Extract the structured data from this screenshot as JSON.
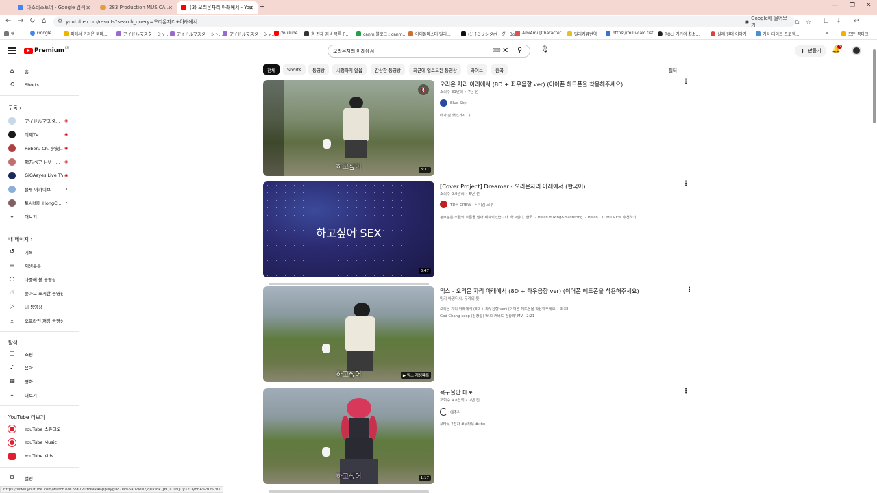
{
  "browser": {
    "tabs": [
      {
        "label": "아소비스토어 - Google 검색",
        "favicon_color": "#4285f4"
      },
      {
        "label": "283 Production MUSICAL Perf",
        "favicon_color": "#e0a040"
      },
      {
        "label": "(3) 오리온자리 아래에서 - You",
        "favicon_color": "#ff0000"
      }
    ],
    "url": "youtube.com/results?search_query=오리온자리+아래에서",
    "google_chip": "Google에 물어보기",
    "bookmarks": [
      {
        "label": "앱",
        "color": "#777"
      },
      {
        "label": "Google",
        "color": "#4285f4"
      },
      {
        "label": "파에서 가져온 북마...",
        "color": "#f0b400"
      },
      {
        "label": "アイドルマスター シャ...",
        "color": "#9a6ad0"
      },
      {
        "label": "アイドルマスター シャ...",
        "color": "#9a6ad0"
      },
      {
        "label": "アイドルマスター シャ...",
        "color": "#9a6ad0"
      },
      {
        "label": "YouTube",
        "color": "#ff0000"
      },
      {
        "label": "홈 전체 검색 목록 F...",
        "color": "#333"
      },
      {
        "label": "canm 블로그 : canm...",
        "color": "#2a9d4a"
      },
      {
        "label": "아이돌마스터 밀리...",
        "color": "#d07030"
      },
      {
        "label": "(1) [ミリシタボーダーBot...",
        "color": "#111"
      },
      {
        "label": "AmiAmi [Character...",
        "color": "#e05050"
      },
      {
        "label": "밀리커뮤번역",
        "color": "#e8c020"
      },
      {
        "label": "https://milli-calc.tist...",
        "color": "#3b6fd0"
      },
      {
        "label": "ROLI 기기의 최소...",
        "color": "#222"
      },
      {
        "label": "실제 원더 이야기",
        "color": "#e04040"
      },
      {
        "label": "기타 데이트 프로젝...",
        "color": "#4a90d0"
      },
      {
        "label": "모든 북마크",
        "color": "#f0b400"
      }
    ]
  },
  "youtube": {
    "logo_text": "Premium",
    "logo_region": "KR",
    "search_query": "오리온자리 아래에서",
    "create_label": "만들기",
    "notif_count": "3"
  },
  "sidebar": {
    "main": [
      {
        "label": "홈",
        "icon": "home-icon",
        "glyph": "⌂"
      },
      {
        "label": "Shorts",
        "icon": "shorts-icon",
        "glyph": "⟲"
      }
    ],
    "subs_header": "구독",
    "subs": [
      {
        "label": "アイドルマスタ...",
        "color": "#c8d8e8",
        "status": "live"
      },
      {
        "label": "미재TV",
        "color": "#1a1a1a",
        "status": "live"
      },
      {
        "label": "Roberu Ch. 夕刻...",
        "color": "#b04040",
        "status": "live"
      },
      {
        "label": "熊乃ベアトリー...",
        "color": "#c07070",
        "status": "live"
      },
      {
        "label": "GiGAeyes Live TV",
        "color": "#1a2a5a",
        "status": "live"
      },
      {
        "label": "블루 아카이브",
        "color": "#8ab0d8",
        "status": "dot"
      },
      {
        "label": "토시네마 HongCi...",
        "color": "#806060",
        "status": "dot"
      }
    ],
    "subs_more": "더보기",
    "you_header": "내 페이지",
    "you": [
      {
        "label": "기록",
        "icon": "history-icon",
        "glyph": "↺"
      },
      {
        "label": "재생목록",
        "icon": "playlist-icon",
        "glyph": "≡"
      },
      {
        "label": "나중에 볼 동영상",
        "icon": "watch-later-icon",
        "glyph": "◷"
      },
      {
        "label": "좋아요 표시한 동영상",
        "icon": "thumbs-up-icon",
        "glyph": "👍"
      },
      {
        "label": "내 동영상",
        "icon": "your-videos-icon",
        "glyph": "▶"
      },
      {
        "label": "오프라인 저장 동영상",
        "icon": "download-icon",
        "glyph": "⤓"
      }
    ],
    "explore_header": "탐색",
    "explore": [
      {
        "label": "쇼핑",
        "icon": "shopping-icon",
        "glyph": "🛍"
      },
      {
        "label": "음악",
        "icon": "music-icon",
        "glyph": "♪"
      },
      {
        "label": "영화",
        "icon": "film-icon",
        "glyph": "▦"
      },
      {
        "label": "더보기",
        "icon": "chevron-down-icon",
        "glyph": "⌄"
      }
    ],
    "more_header": "YouTube 더보기",
    "more": [
      {
        "label": "YouTube 스튜디오",
        "icon": "studio-icon"
      },
      {
        "label": "YouTube Music",
        "icon": "yt-music-icon"
      },
      {
        "label": "YouTube Kids",
        "icon": "yt-kids-icon"
      }
    ],
    "settings": "설정"
  },
  "chips": [
    "전체",
    "Shorts",
    "동영상",
    "시청하지 않음",
    "감상한 동영상",
    "최근에 업로드된 동영상",
    "라이브",
    "원곡"
  ],
  "filter_label": "필터",
  "results": [
    {
      "title": "오리온 자리 아래에서 (8D + 좌우음향 ver) (이어폰 헤드폰을 착용해주세요)",
      "meta": "조회수 31만회 • 7년 전",
      "channel": "Blue Sky",
      "channel_color": "#2a4aa0",
      "desc": "내가 잘 했었거지...)",
      "desc2": "",
      "duration": "3:37",
      "caption": "하고싶어",
      "thumb_kind": "field"
    },
    {
      "title": "[Cover Project] Dreamer - 오리온자리 아래에서 (한국어)",
      "meta": "조회수 9.9만회 • 5년 전",
      "channel": "TDM CREW - 티디엠 크루",
      "channel_color": "#c02020",
      "desc": "정부분은 소원의 흐름을 받아 제작되었습니다. 학교실다, 한국 G.Hwan mixing&mastering G.Hwan · TDM CREW 추천하기 ...",
      "desc2": "",
      "duration": "3:47",
      "caption": "하고싶어 SEX",
      "thumb_kind": "galaxy"
    },
    {
      "title": "믹스 - 오리온 자리 아래에서 (8D + 좌우음향 ver) (이어폰 헤드폰을 착용해주세요)",
      "meta": "밍키 아밍티시, 우리의 뜻",
      "channel": "",
      "channel_color": "",
      "desc": "오리온 자리 아래에서 (8D + 좌우음향 ver) (이어폰 헤드폰을 착용해주세요) · 3:38",
      "desc2": "God Chang-seop (신창섭) '비오 커버도 정상화' MV · 2:21",
      "duration": "믹스 재생목록",
      "caption": "하고싶어",
      "thumb_kind": "field"
    },
    {
      "title": "욕구불만 테토",
      "meta": "조회수 4.8만회 • 2년 전",
      "channel": "예추리",
      "channel_color": "#ffffff",
      "desc": "우타우 2집자 #우타우 #utau",
      "desc2": "",
      "duration": "1:17",
      "caption": "하고싶어",
      "thumb_kind": "teto"
    }
  ],
  "status_url": "https://www.youtube.com/watch?v=2oX7P0YHNR4&pp=ygUc7Iik66a07Ie07JqU7Iqk7J6QIOuVjOyXkOyEnA%3D%3D"
}
